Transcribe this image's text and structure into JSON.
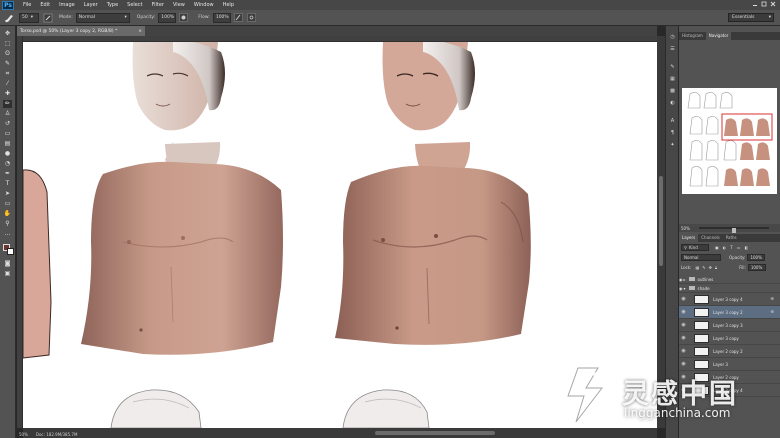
{
  "app": {
    "logo": "Ps"
  },
  "menu": [
    "File",
    "Edit",
    "Image",
    "Layer",
    "Type",
    "Select",
    "Filter",
    "View",
    "Window",
    "Help"
  ],
  "options": {
    "brush_size": "50",
    "mode_label": "Mode:",
    "mode_value": "Normal",
    "opacity_label": "Opacity:",
    "opacity_value": "100%",
    "flow_label": "Flow:",
    "flow_value": "100%",
    "workspace": "Essentials"
  },
  "document": {
    "tab_title": "Torso.psd @ 50% (Layer 3 copy 2, RGB/8) *",
    "zoom": "50%",
    "doc_info": "Doc: 182.9M/385.7M"
  },
  "panels": {
    "top_tabs": [
      "Histogram",
      "Navigator"
    ],
    "zoom_value": "50%",
    "layer_tabs": [
      "Layers",
      "Channels",
      "Paths"
    ],
    "kind_filter": "Kind",
    "blend_mode": "Normal",
    "opacity_label": "Opacity:",
    "opacity_value": "100%",
    "lock_label": "Lock:",
    "fill_label": "Fill:",
    "fill_value": "100%"
  },
  "layers": {
    "groups": [
      "outlines",
      "shade"
    ],
    "items": [
      {
        "name": "Layer 3 copy 4",
        "selected": false
      },
      {
        "name": "Layer 3 copy 2",
        "selected": true
      },
      {
        "name": "Layer 3 copy 3",
        "selected": false
      },
      {
        "name": "Layer 3 copy",
        "selected": false
      },
      {
        "name": "Layer 2 copy 2",
        "selected": false
      },
      {
        "name": "Layer 3",
        "selected": false
      },
      {
        "name": "Layer 2 copy",
        "selected": false
      },
      {
        "name": "Layer 2 copy 4",
        "selected": false
      }
    ]
  },
  "watermark": {
    "chinese": "灵感中国",
    "url": "lingganchina.com"
  },
  "colors": {
    "skin": "#c79a88",
    "skin_shadow": "#8f645a",
    "hair": "#d9d6d6",
    "selection": "#5d6d82"
  }
}
